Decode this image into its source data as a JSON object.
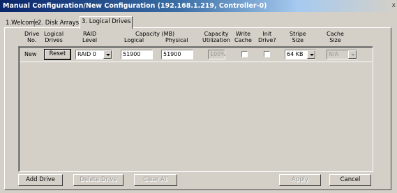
{
  "window": {
    "title": "Manual Configuration/New Configuration (192.168.1.219, Controller-0)",
    "close_glyph": "x"
  },
  "tabs": [
    {
      "label": "1.Welcome"
    },
    {
      "label": "2. Disk Arrays"
    },
    {
      "label": "3. Logical Drives",
      "active": true
    }
  ],
  "columns": {
    "drive_no": "Drive\nNo.",
    "logical_drives": "Logical\nDrives",
    "raid_level": "RAID\nLevel",
    "capacity": "Capacity (MB)",
    "logical": "Logical",
    "physical": "Physical",
    "capacity_util": "Capacity\nUtilization",
    "write_cache": "Write\nCache",
    "init_drive": "Init\nDrive?",
    "stripe_size": "Stripe\nSize",
    "cache_size": "Cache\nSize"
  },
  "row": {
    "drive_no": "New",
    "reset_label": "Reset",
    "raid_level": "RAID 0",
    "logical_capacity": "51900",
    "physical_capacity": "51900",
    "utilization": "100%",
    "write_cache_checked": false,
    "init_drive_checked": false,
    "stripe_size": "64 KB",
    "cache_size": "N/A"
  },
  "buttons": {
    "add_drive": "Add Drive",
    "delete_drive": "Delete Drive",
    "clear_all": "Clear All",
    "apply": "Apply",
    "cancel": "Cancel"
  }
}
